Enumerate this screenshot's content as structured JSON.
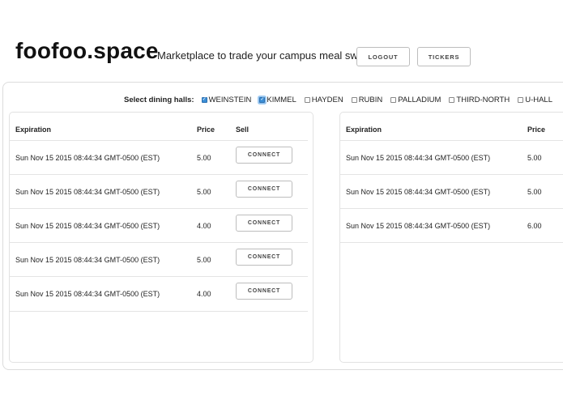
{
  "header": {
    "brand": "foofoo.space",
    "tagline": "Marketplace to trade your campus meal swipes!",
    "logout_label": "LOGOUT",
    "tickers_label": "TICKERS"
  },
  "filters": {
    "label": "Select dining halls:",
    "halls": [
      {
        "name": "WEINSTEIN",
        "checked": true
      },
      {
        "name": "KIMMEL",
        "checked": true
      },
      {
        "name": "HAYDEN",
        "checked": false
      },
      {
        "name": "RUBIN",
        "checked": false
      },
      {
        "name": "PALLADIUM",
        "checked": false
      },
      {
        "name": "THIRD-NORTH",
        "checked": false
      },
      {
        "name": "U-HALL",
        "checked": false
      }
    ]
  },
  "sell_table": {
    "columns": {
      "expiration": "Expiration",
      "price": "Price",
      "action": "Sell"
    },
    "button_label": "CONNECT",
    "rows": [
      {
        "expiration": "Sun Nov 15 2015 08:44:34 GMT-0500 (EST)",
        "price": "5.00"
      },
      {
        "expiration": "Sun Nov 15 2015 08:44:34 GMT-0500 (EST)",
        "price": "5.00"
      },
      {
        "expiration": "Sun Nov 15 2015 08:44:34 GMT-0500 (EST)",
        "price": "4.00"
      },
      {
        "expiration": "Sun Nov 15 2015 08:44:34 GMT-0500 (EST)",
        "price": "5.00"
      },
      {
        "expiration": "Sun Nov 15 2015 08:44:34 GMT-0500 (EST)",
        "price": "4.00"
      }
    ]
  },
  "buy_table": {
    "columns": {
      "expiration": "Expiration",
      "price": "Price"
    },
    "rows": [
      {
        "expiration": "Sun Nov 15 2015 08:44:34 GMT-0500 (EST)",
        "price": "5.00"
      },
      {
        "expiration": "Sun Nov 15 2015 08:44:34 GMT-0500 (EST)",
        "price": "5.00"
      },
      {
        "expiration": "Sun Nov 15 2015 08:44:34 GMT-0500 (EST)",
        "price": "6.00"
      }
    ]
  }
}
